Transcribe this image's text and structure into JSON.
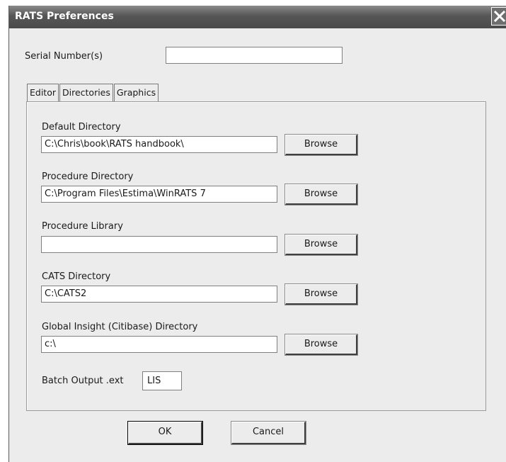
{
  "window": {
    "title": "RATS Preferences"
  },
  "serial": {
    "label": "Serial Number(s)",
    "value": ""
  },
  "tabs": [
    {
      "label": "Editor"
    },
    {
      "label": "Directories"
    },
    {
      "label": "Graphics"
    }
  ],
  "directories": {
    "browse_label": "Browse",
    "fields": [
      {
        "label": "Default Directory",
        "value": "C:\\Chris\\book\\RATS handbook\\"
      },
      {
        "label": "Procedure Directory",
        "value": "C:\\Program Files\\Estima\\WinRATS 7"
      },
      {
        "label": "Procedure Library",
        "value": ""
      },
      {
        "label": "CATS Directory",
        "value": "C:\\CATS2"
      },
      {
        "label": "Global Insight (Citibase) Directory",
        "value": "c:\\"
      }
    ],
    "batch": {
      "label": "Batch Output .ext",
      "value": "LIS"
    }
  },
  "buttons": {
    "ok": "OK",
    "cancel": "Cancel"
  }
}
